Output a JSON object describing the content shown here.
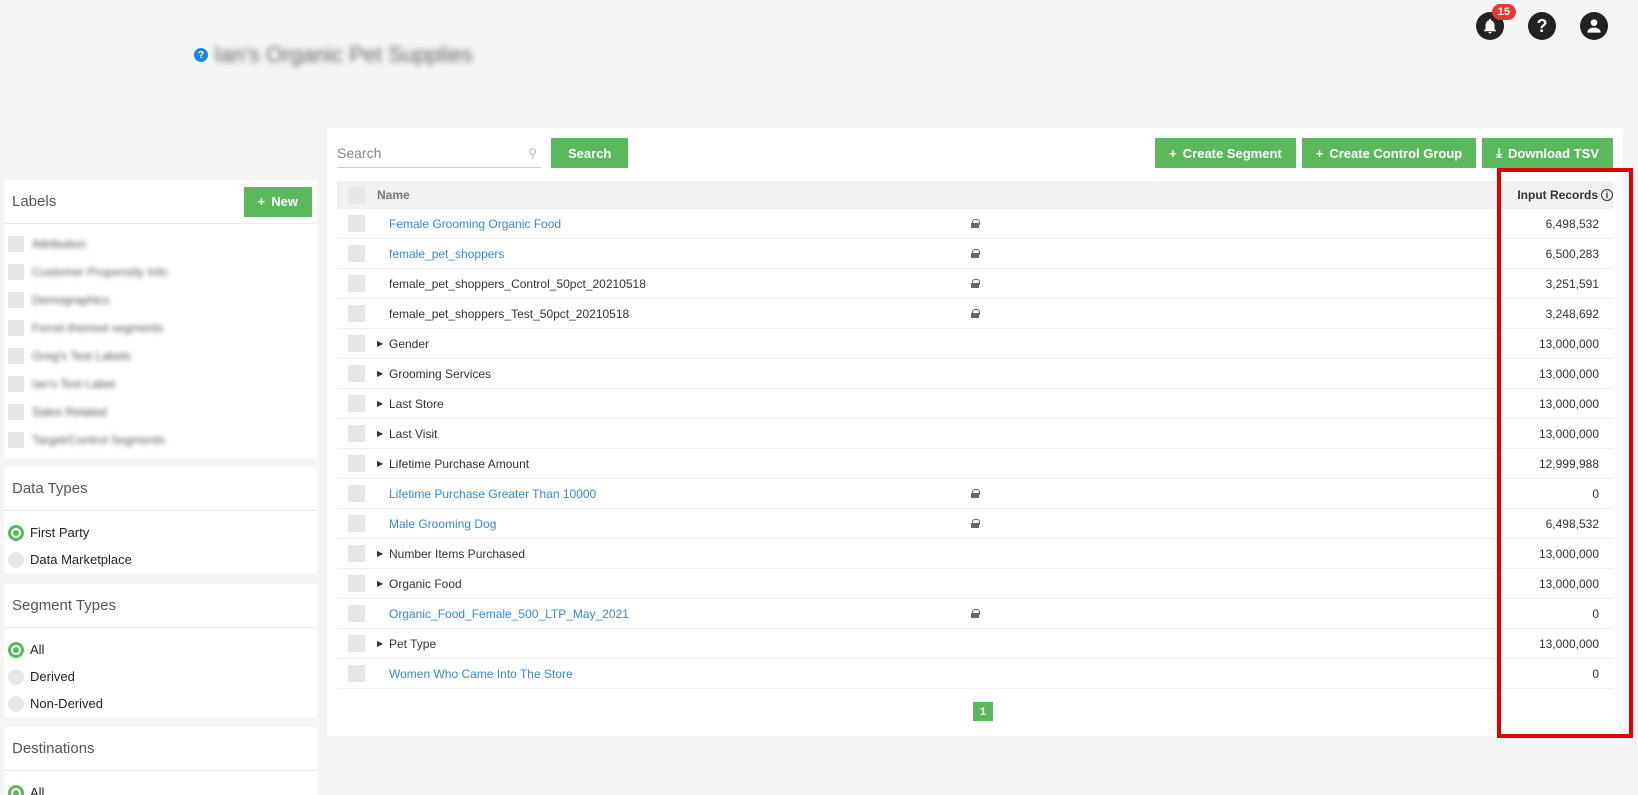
{
  "header": {
    "notifications_count": "15",
    "help_glyph": "?",
    "brand_help_glyph": "?",
    "brand_name": "Ian's Organic Pet Supplies"
  },
  "labels_panel": {
    "title": "Labels",
    "new_button": "New",
    "items": [
      "Attribution",
      "Customer Propensity Info",
      "Demographics",
      "Ferret-themed segments",
      "Greg's Test Labels",
      "Ian's Test Label",
      "Sales Related",
      "Target/Control Segments"
    ]
  },
  "data_types": {
    "title": "Data Types",
    "options": [
      {
        "label": "First Party",
        "selected": true
      },
      {
        "label": "Data Marketplace",
        "selected": false
      }
    ]
  },
  "segment_types": {
    "title": "Segment Types",
    "options": [
      {
        "label": "All",
        "selected": true
      },
      {
        "label": "Derived",
        "selected": false
      },
      {
        "label": "Non-Derived",
        "selected": false
      }
    ]
  },
  "destinations": {
    "title": "Destinations",
    "options": [
      {
        "label": "All",
        "selected": true
      }
    ]
  },
  "toolbar": {
    "search_placeholder": "Search",
    "search_button": "Search",
    "create_segment": "Create Segment",
    "create_control_group": "Create Control Group",
    "download_tsv": "Download TSV"
  },
  "table": {
    "col_name": "Name",
    "col_records": "Input Records",
    "rows": [
      {
        "name": "Female Grooming Organic Food",
        "type": "link",
        "locked": true,
        "records": "6,498,532"
      },
      {
        "name": "female_pet_shoppers",
        "type": "link",
        "locked": true,
        "records": "6,500,283"
      },
      {
        "name": "female_pet_shoppers_Control_50pct_20210518",
        "type": "plain",
        "locked": true,
        "records": "3,251,591"
      },
      {
        "name": "female_pet_shoppers_Test_50pct_20210518",
        "type": "plain",
        "locked": true,
        "records": "3,248,692"
      },
      {
        "name": "Gender",
        "type": "group",
        "locked": false,
        "records": "13,000,000"
      },
      {
        "name": "Grooming Services",
        "type": "group",
        "locked": false,
        "records": "13,000,000"
      },
      {
        "name": "Last Store",
        "type": "group",
        "locked": false,
        "records": "13,000,000"
      },
      {
        "name": "Last Visit",
        "type": "group",
        "locked": false,
        "records": "13,000,000"
      },
      {
        "name": "Lifetime Purchase Amount",
        "type": "group",
        "locked": false,
        "records": "12,999,988"
      },
      {
        "name": "Lifetime Purchase Greater Than 10000",
        "type": "link",
        "locked": true,
        "records": "0"
      },
      {
        "name": "Male Grooming Dog",
        "type": "link",
        "locked": true,
        "records": "6,498,532"
      },
      {
        "name": "Number Items Purchased",
        "type": "group",
        "locked": false,
        "records": "13,000,000"
      },
      {
        "name": "Organic Food",
        "type": "group",
        "locked": false,
        "records": "13,000,000"
      },
      {
        "name": "Organic_Food_Female_500_LTP_May_2021",
        "type": "link",
        "locked": true,
        "records": "0"
      },
      {
        "name": "Pet Type",
        "type": "group",
        "locked": false,
        "records": "13,000,000"
      },
      {
        "name": "Women Who Came Into The Store",
        "type": "link",
        "locked": false,
        "records": "0"
      }
    ]
  },
  "pager": {
    "current": "1"
  },
  "colors": {
    "accent": "#5cb85c",
    "link": "#3a87c8",
    "highlight": "#e00000",
    "badge": "#e53935"
  }
}
